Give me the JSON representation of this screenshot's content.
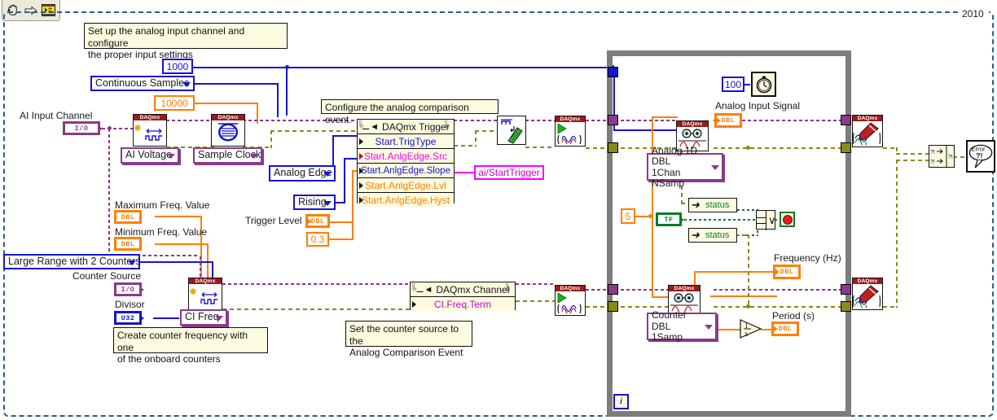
{
  "window": {
    "year_label": "2010",
    "toolbar": {
      "buttons": [
        {
          "name": "hand-tool",
          "glyph": "✋"
        },
        {
          "name": "run-arrow",
          "glyph": "➡"
        },
        {
          "name": "vi-icon",
          "glyph": "▣"
        }
      ]
    }
  },
  "comments": [
    {
      "id": "c1",
      "text": "Set up the analog input channel and configure\nthe proper input settings"
    },
    {
      "id": "c2",
      "text": "Configure the analog comparison event."
    },
    {
      "id": "c3",
      "text": "Create counter frequency with one\nof the onboard counters"
    },
    {
      "id": "c4",
      "text": "Set the counter source to the\nAnalog Comparison Event"
    }
  ],
  "labels": {
    "ai_input_channel": "AI Input Channel",
    "maximum_freq": "Maximum Freq. Value",
    "minimum_freq": "Minimum Freq. Value",
    "counter_source": "Counter Source",
    "divisor": "Divisor",
    "trigger_level": "Trigger Level",
    "analog_input_signal": "Analog Input Signal",
    "frequency_hz": "Frequency (Hz)",
    "period_s": "Period (s)"
  },
  "constants": {
    "samples_per_chan": "1000",
    "rate": "10000",
    "trigger_level_value": "0.3",
    "wait_ms": "100",
    "counter_samples": "5"
  },
  "enums": {
    "sample_mode": "Continuous Samples",
    "ai_measurement_type": "AI Voltage",
    "sample_clock": "Sample Clock",
    "trigger_type": "Analog Edge",
    "slope": "Rising",
    "counter_method": "Large Range with 2 Counters",
    "ci_measurement_type": "CI Freq",
    "read_analog": "Analog 1D DBL\n1Chan NSamp",
    "read_counter": "Counter DBL\n1Samp"
  },
  "terminals": {
    "io_channel": "I/O",
    "dbl": "DBL",
    "u32": "U32",
    "tf": "TF"
  },
  "property_nodes": [
    {
      "id": "trigger",
      "title": "DAQmx Trigger",
      "properties": [
        {
          "name": "Start.TrigType",
          "color": "#1414d2"
        },
        {
          "name": "Start.AnlgEdge.Src",
          "color": "#ff00ff"
        },
        {
          "name": "Start.AnlgEdge.Slope",
          "color": "#1414d2"
        },
        {
          "name": "Start.AnlgEdge.Lvl",
          "color": "#ff7f00"
        },
        {
          "name": "Start.AnlgEdge.Hyst",
          "color": "#ff7f00"
        }
      ]
    },
    {
      "id": "channel",
      "title": "DAQmx Channel",
      "properties": [
        {
          "name": "CI.Freq.Term",
          "color": "#cc00cc"
        }
      ]
    }
  ],
  "string_constants": {
    "start_trigger_source": "ai/StartTrigger"
  },
  "loop": {
    "iteration_terminal": "i",
    "status_left": "status",
    "status_right": "status",
    "or_symbol": "∨"
  },
  "error_handler": {
    "label_top": "Error",
    "label_bottom": "?!"
  },
  "colors": {
    "wire_io": "#8a3a8a",
    "wire_numeric_blue": "#1414d2",
    "wire_double": "#ff7f00",
    "wire_error": "#8a8a1a",
    "wire_string": "#ff00ff",
    "wire_boolean": "#0a7a28",
    "loop_border": "#7d7d7d",
    "comment_bg": "#fcfbe0",
    "daqmx_header": "#9b1b1b"
  }
}
